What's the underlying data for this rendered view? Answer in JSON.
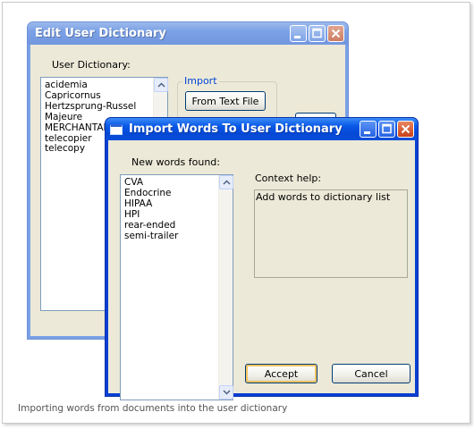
{
  "edit_dialog": {
    "title": "Edit User Dictionary",
    "dictionary_label": "User Dictionary:",
    "words": [
      "acidemia",
      "Capricornus",
      "Hertzsprung-Russel",
      "Majeure",
      "MERCHANTABIL",
      "telecopier",
      "telecopy"
    ],
    "import_group_label": "Import",
    "from_text_file_label": "From Text File"
  },
  "import_dialog": {
    "title": "Import Words To User Dictionary",
    "new_words_label": "New words found:",
    "words": [
      "CVA",
      "Endocrine",
      "HIPAA",
      "HPI",
      "rear-ended",
      "semi-trailer"
    ],
    "context_help_label": "Context help:",
    "context_help_text": "Add words to dictionary list",
    "accept_label": "Accept",
    "cancel_label": "Cancel"
  },
  "caption": "Importing words from documents into the user dictionary",
  "colors": {
    "titlebar_active": "#0a5ae8",
    "titlebar_inactive": "#7aa1e6",
    "dialog_face": "#ece9d8",
    "group_label": "#0046d5",
    "close_button": "#c8421a"
  },
  "icons": [
    "window-icon",
    "minimize-icon",
    "maximize-icon",
    "close-icon",
    "scroll-up-icon",
    "scroll-down-icon"
  ]
}
